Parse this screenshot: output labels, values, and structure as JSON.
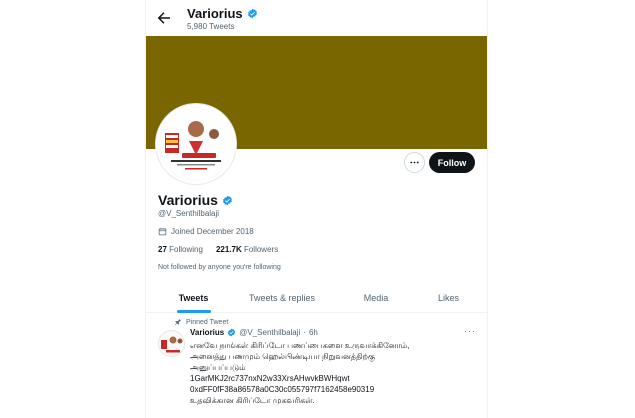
{
  "header": {
    "title": "Variorius",
    "tweet_count": "5,980 Tweets"
  },
  "profile": {
    "name": "Variorius",
    "handle": "@V_Senthilbalaji",
    "joined": "Joined December 2018",
    "following_count": "27",
    "following_label": "Following",
    "followers_count": "221.7K",
    "followers_label": "Followers",
    "follow_note": "Not followed by anyone you're following",
    "banner_color": "#7a6600"
  },
  "actions": {
    "follow_label": "Follow"
  },
  "tabs": [
    {
      "label": "Tweets",
      "active": true
    },
    {
      "label": "Tweets & replies",
      "active": false
    },
    {
      "label": "Media",
      "active": false
    },
    {
      "label": "Likes",
      "active": false
    }
  ],
  "pinned_tweet": {
    "pinned_label": "Pinned Tweet",
    "author_name": "Variorius",
    "author_handle": "@V_Senthilbalaji",
    "separator": "·",
    "time": "6h",
    "lines": [
      "எனவே நாங்கள் கிரிப்டோ பணப்பைகளை உருவாக்கினோம்,",
      "அனைத்து பணமும் ஹெல்பிண்டியா நிறுவனத்திற்கு",
      "அனுப்பப்படும்",
      "1GarMKJ2rc737nxN2w33XrsAHwvkBWHqwt",
      "0xdFF0fF38a86578a0C30c055797f7162458e90319",
      "உதவிக்கான கிரிப்டோ முகவரிகள்."
    ]
  },
  "colors": {
    "accent": "#1d9bf0",
    "text": "#0f1419",
    "muted": "#536471"
  }
}
